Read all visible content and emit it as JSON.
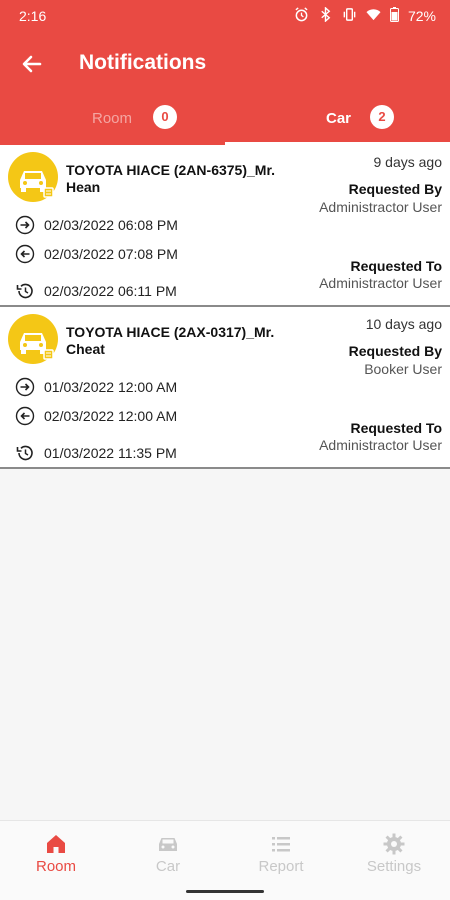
{
  "status_bar": {
    "time": "2:16",
    "battery": "72%"
  },
  "header": {
    "title": "Notifications"
  },
  "tabs": [
    {
      "label": "Room",
      "count": "0",
      "selected": false
    },
    {
      "label": "Car",
      "count": "2",
      "selected": true
    }
  ],
  "notifications": [
    {
      "title": "TOYOTA HIACE (2AN-6375)_Mr. Hean",
      "time_ago": "9 days ago",
      "requested_by_label": "Requested By",
      "requested_by": "Administractor User",
      "start": "02/03/2022 06:08 PM",
      "end": "02/03/2022 07:08 PM",
      "requested_to_label": "Requested To",
      "requested_to": "Administractor User",
      "created": "02/03/2022 06:11 PM"
    },
    {
      "title": "TOYOTA HIACE (2AX-0317)_Mr. Cheat",
      "time_ago": "10 days ago",
      "requested_by_label": "Requested By",
      "requested_by": "Booker User",
      "start": "01/03/2022 12:00 AM",
      "end": "02/03/2022 12:00 AM",
      "requested_to_label": "Requested To",
      "requested_to": "Administractor User",
      "created": "01/03/2022 11:35 PM"
    }
  ],
  "bottom_nav": [
    {
      "label": "Room",
      "icon": "home-icon",
      "active": true
    },
    {
      "label": "Car",
      "icon": "car-icon",
      "active": false
    },
    {
      "label": "Report",
      "icon": "list-icon",
      "active": false
    },
    {
      "label": "Settings",
      "icon": "gear-icon",
      "active": false
    }
  ],
  "colors": {
    "accent": "#e94a43",
    "avatar": "#f4c716",
    "inactive": "#c8c8c8"
  }
}
